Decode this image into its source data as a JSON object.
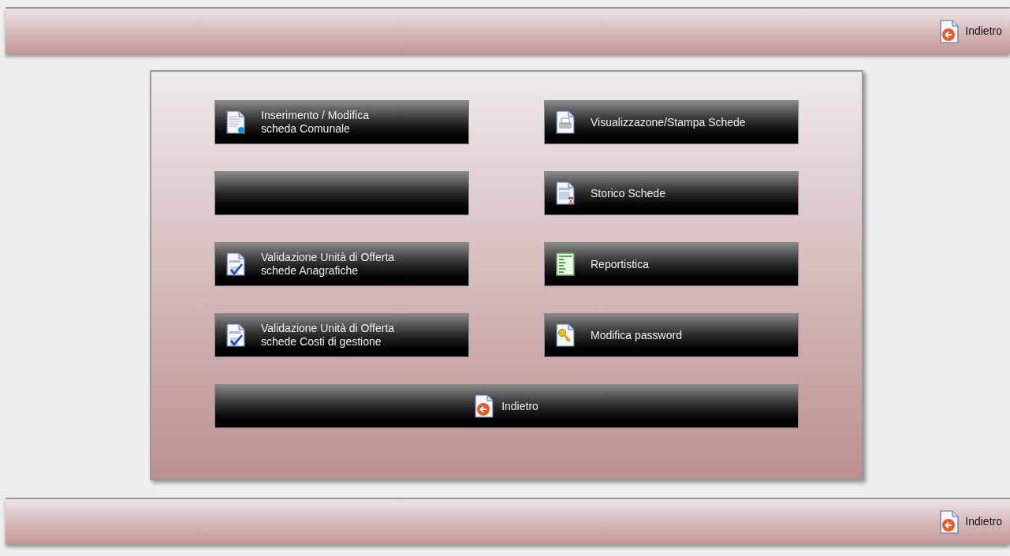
{
  "top_bar": {
    "back_link": "Indietro"
  },
  "menu": {
    "buttons": [
      {
        "kind": "labeled",
        "label": "Inserimento / Modifica\nscheda Comunale"
      },
      {
        "kind": "labeled",
        "label": "Visualizzazone/Stampa Schede"
      },
      {
        "kind": "blank"
      },
      {
        "kind": "labeled",
        "label": "Storico Schede"
      },
      {
        "kind": "labeled",
        "label": "Validazione Unità di Offerta\nschede Anagrafiche"
      },
      {
        "kind": "labeled",
        "label": "Reportistica"
      },
      {
        "kind": "labeled",
        "label": "Validazione Unità di Offerta\nschede Costi di gestione"
      },
      {
        "kind": "labeled",
        "label": "Modifica password"
      }
    ],
    "back_button": "Indietro"
  },
  "bottom_bar": {
    "back_link": "Indietro"
  }
}
